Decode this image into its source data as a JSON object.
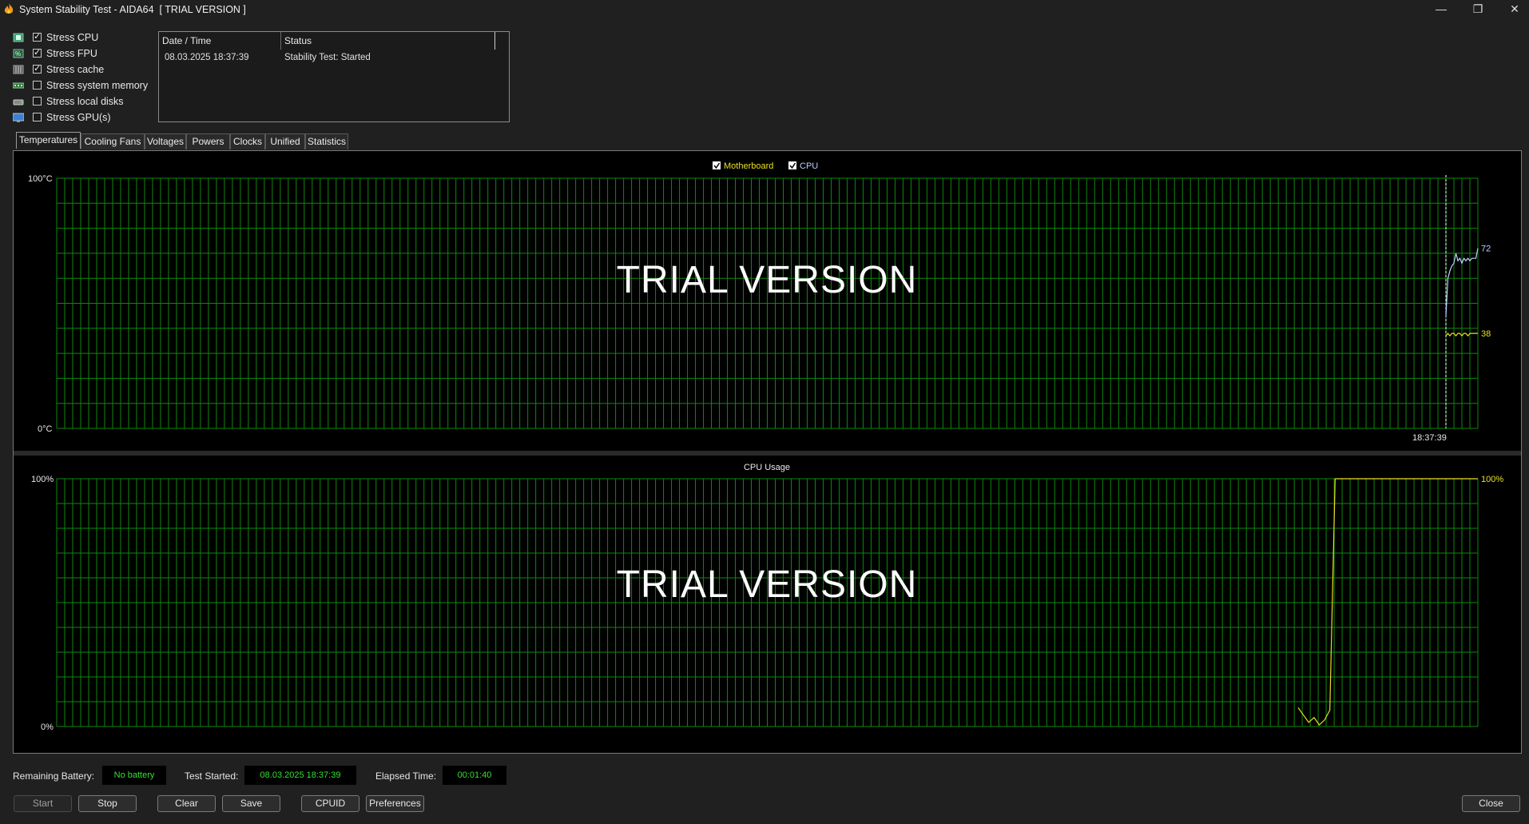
{
  "window": {
    "title": "System Stability Test - AIDA64  [ TRIAL VERSION ]",
    "minimize": "—",
    "restore": "❐",
    "close": "✕"
  },
  "stress_options": [
    {
      "label": "Stress CPU",
      "checked": true,
      "icon": "cpu-icon"
    },
    {
      "label": "Stress FPU",
      "checked": true,
      "icon": "fpu-icon"
    },
    {
      "label": "Stress cache",
      "checked": true,
      "icon": "cache-icon"
    },
    {
      "label": "Stress system memory",
      "checked": false,
      "icon": "memory-icon"
    },
    {
      "label": "Stress local disks",
      "checked": false,
      "icon": "disk-icon"
    },
    {
      "label": "Stress GPU(s)",
      "checked": false,
      "icon": "gpu-icon"
    }
  ],
  "status_log": {
    "columns": [
      "Date / Time",
      "Status"
    ],
    "rows": [
      [
        "08.03.2025 18:37:39",
        "Stability Test: Started"
      ]
    ]
  },
  "tabs": [
    "Temperatures",
    "Cooling Fans",
    "Voltages",
    "Powers",
    "Clocks",
    "Unified",
    "Statistics"
  ],
  "active_tab": "Temperatures",
  "watermark": "TRIAL VERSION",
  "colors": {
    "grid": "#0c8a0c",
    "motherboard": "#e8e020",
    "cpu": "#b8d0ff",
    "usage": "#e8e020",
    "value_text": "#33e033"
  },
  "chart_data": [
    {
      "type": "line",
      "name": "temperatures",
      "legend": [
        {
          "label": "Motherboard",
          "checked": true
        },
        {
          "label": "CPU",
          "checked": true
        }
      ],
      "ylim": [
        0,
        100
      ],
      "ytick_labels": [
        "100°C",
        "0°C"
      ],
      "x_marker_label": "18:37:39",
      "series": [
        {
          "name": "CPU",
          "values": [
            45,
            60,
            63,
            65,
            66,
            70,
            67,
            68,
            66,
            68,
            67,
            68,
            67,
            68,
            68,
            68,
            72
          ],
          "last_label": "72"
        },
        {
          "name": "Motherboard",
          "values": [
            37,
            38,
            37,
            38,
            38,
            37,
            38,
            38,
            37,
            38,
            38,
            37,
            38,
            38,
            38,
            38,
            38
          ],
          "last_label": "38"
        }
      ]
    },
    {
      "type": "line",
      "name": "cpu-usage",
      "title": "CPU Usage",
      "ylim": [
        0,
        100
      ],
      "ytick_labels": [
        "100%",
        "0%"
      ],
      "series": [
        {
          "name": "CPU Usage",
          "values": [
            7,
            4,
            1,
            3,
            0,
            2,
            6,
            100,
            100,
            100,
            100,
            100,
            100,
            100,
            100,
            100,
            100,
            100,
            100,
            100,
            100,
            100,
            100,
            100,
            100,
            100,
            100,
            100,
            100,
            100,
            100,
            100,
            100,
            100,
            100
          ],
          "last_label": "100%"
        }
      ]
    }
  ],
  "footer": {
    "battery_label": "Remaining Battery:",
    "battery_value": "No battery",
    "started_label": "Test Started:",
    "started_value": "08.03.2025 18:37:39",
    "elapsed_label": "Elapsed Time:",
    "elapsed_value": "00:01:40"
  },
  "buttons": {
    "start": "Start",
    "stop": "Stop",
    "clear": "Clear",
    "save": "Save",
    "cpuid": "CPUID",
    "preferences": "Preferences",
    "close": "Close"
  }
}
